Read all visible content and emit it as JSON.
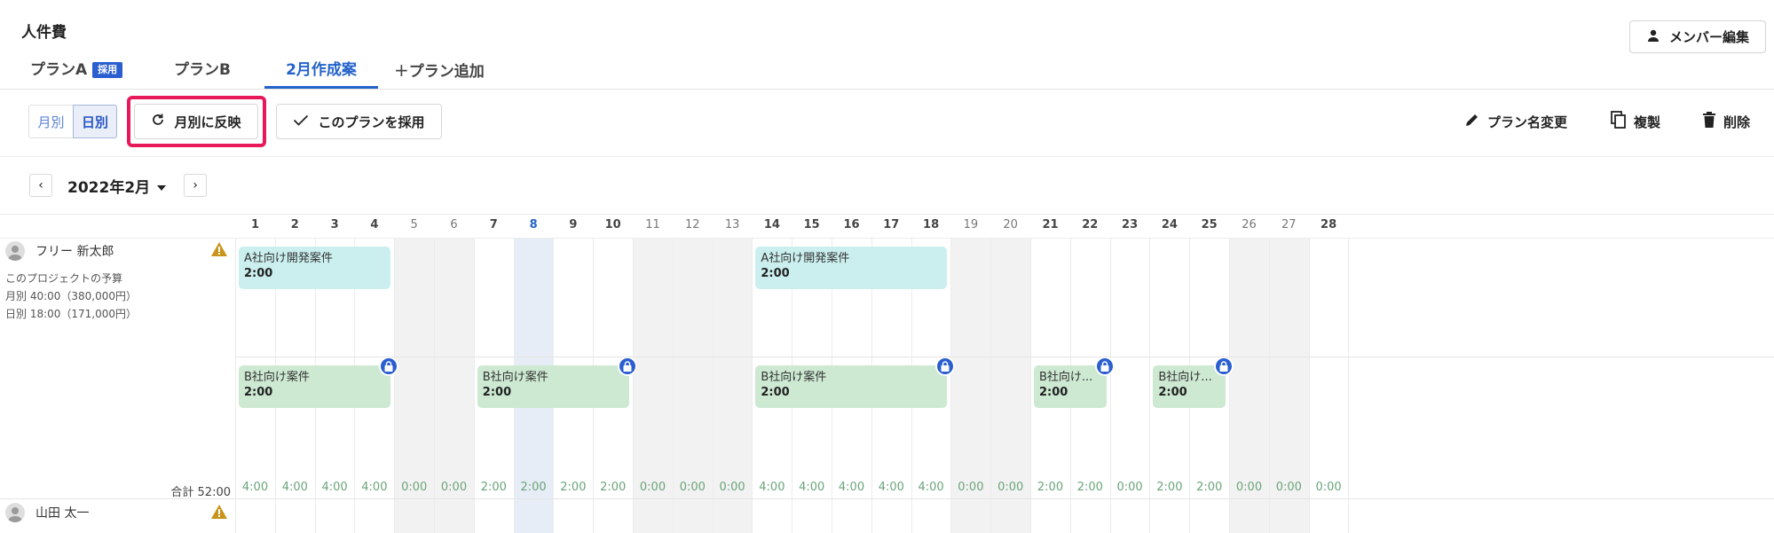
{
  "page_title": "人件費",
  "member_edit_label": "メンバー編集",
  "tabs": [
    {
      "label": "プランA",
      "badge": "採用"
    },
    {
      "label": "プランB"
    },
    {
      "label": "2月作成案"
    },
    {
      "label": "プラン追加"
    }
  ],
  "view_toggle": {
    "monthly": "月別",
    "daily": "日別"
  },
  "reflect_label": "月別に反映",
  "adopt_label": "このプランを採用",
  "actions": {
    "rename": "プラン名変更",
    "copy": "複製",
    "delete": "削除"
  },
  "month": "2022年2月",
  "days": [
    1,
    2,
    3,
    4,
    5,
    6,
    7,
    8,
    9,
    10,
    11,
    12,
    13,
    14,
    15,
    16,
    17,
    18,
    19,
    20,
    21,
    22,
    23,
    24,
    25,
    26,
    27,
    28
  ],
  "weekend_days": [
    5,
    6,
    11,
    12,
    13,
    19,
    20,
    26,
    27
  ],
  "today": 8,
  "members": [
    {
      "name": "フリー 新太郎",
      "budget_title": "このプロジェクトの予算",
      "budget_monthly": "月別 40:00（380,000円）",
      "budget_daily": "日別 18:00（171,000円）",
      "total_label": "合計 52:00",
      "daily_totals": [
        "4:00",
        "4:00",
        "4:00",
        "4:00",
        "0:00",
        "0:00",
        "2:00",
        "2:00",
        "2:00",
        "2:00",
        "0:00",
        "0:00",
        "0:00",
        "4:00",
        "4:00",
        "4:00",
        "4:00",
        "4:00",
        "0:00",
        "0:00",
        "2:00",
        "2:00",
        "0:00",
        "2:00",
        "2:00",
        "0:00",
        "0:00",
        "0:00"
      ],
      "tasks": [
        {
          "name": "A社向け開発案件",
          "hours": "2:00",
          "color": "cyan",
          "start": 1,
          "end": 4,
          "row": 0,
          "locked": false
        },
        {
          "name": "A社向け開発案件",
          "hours": "2:00",
          "color": "cyan",
          "start": 14,
          "end": 18,
          "row": 0,
          "locked": false
        },
        {
          "name": "B社向け案件",
          "hours": "2:00",
          "color": "green",
          "start": 1,
          "end": 4,
          "row": 1,
          "locked": true
        },
        {
          "name": "B社向け案件",
          "hours": "2:00",
          "color": "green",
          "start": 7,
          "end": 10,
          "row": 1,
          "locked": true
        },
        {
          "name": "B社向け案件",
          "hours": "2:00",
          "color": "green",
          "start": 14,
          "end": 18,
          "row": 1,
          "locked": true
        },
        {
          "name": "B社向け...",
          "hours": "2:00",
          "color": "green",
          "start": 21,
          "end": 22,
          "row": 1,
          "locked": true
        },
        {
          "name": "B社向け...",
          "hours": "2:00",
          "color": "green",
          "start": 24,
          "end": 25,
          "row": 1,
          "locked": true
        }
      ]
    },
    {
      "name": "山田 太一"
    }
  ],
  "colors": {
    "accent": "#2563c9",
    "highlight": "#e8195a",
    "cyan_task": "#cbefef",
    "green_task": "#cde9d2",
    "lock": "#2b5fd0"
  }
}
